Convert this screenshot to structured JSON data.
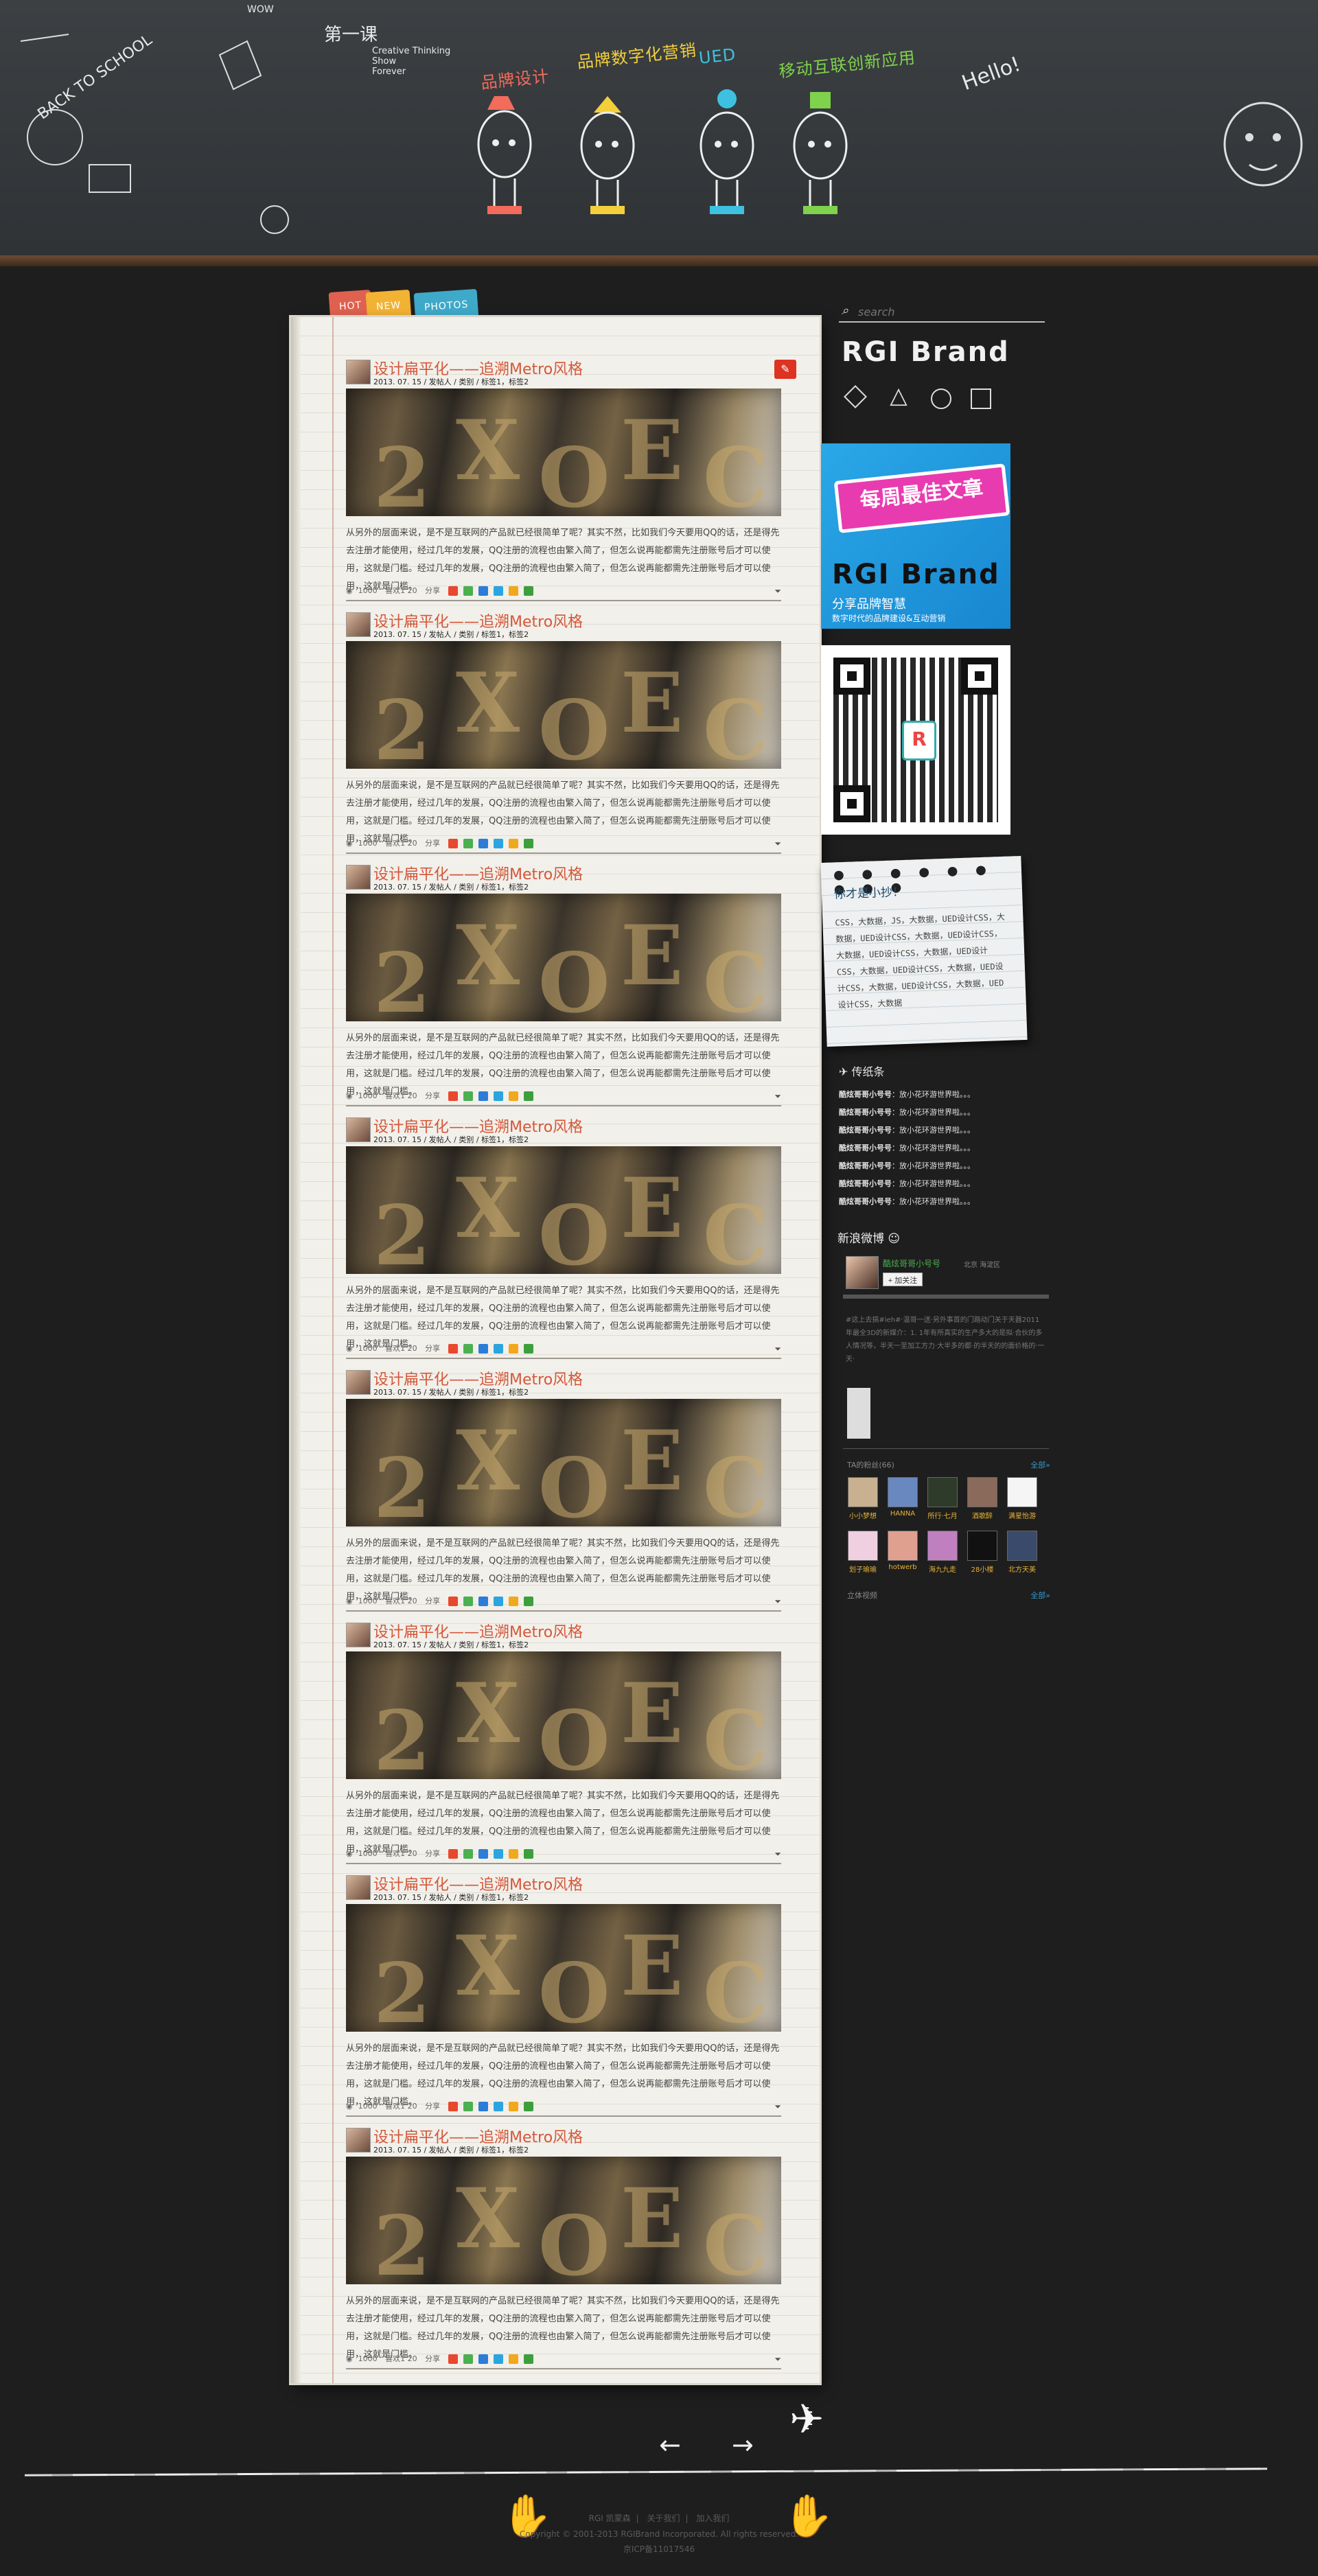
{
  "header": {
    "slogan_lines": [
      "第一课",
      "Creative Thinking",
      "Show",
      "Forever"
    ],
    "categories": [
      {
        "label": "品牌设计",
        "color": "#f26b5b"
      },
      {
        "label": "品牌数字化营销",
        "color": "#f3cf3c"
      },
      {
        "label": "UED",
        "color": "#3ec1e0"
      },
      {
        "label": "移动互联创新应用",
        "color": "#7fd24b"
      }
    ],
    "chalk_words": [
      "BACK TO SCHOOL",
      "WOW",
      "Hello!"
    ]
  },
  "tabs": [
    {
      "label": "HOT",
      "color": "#e0614f"
    },
    {
      "label": "NEW",
      "color": "#f2b233"
    },
    {
      "label": "PHOTOS",
      "color": "#3fa9c9"
    }
  ],
  "posts": [
    {
      "title": "设计扁平化——追溯Metro风格",
      "meta": "2013. 07. 15 / 发帖人 / 类别 / 标签1，标签2",
      "excerpt": "从另外的层面来说，是不是互联网的产品就已经很简单了呢？其实不然，比如我们今天要用QQ的话，还是得先去注册才能使用，经过几年的发展，QQ注册的流程也由繁入简了，但怎么说再能都需先注册账号后才可以使用，这就是门槛。经过几年的发展，QQ注册的流程也由繁入简了，但怎么说再能都需先注册账号后才可以使用，这就是门槛。",
      "views": "1000",
      "likes": "喜欢1 20",
      "share": "分享"
    },
    {
      "title": "设计扁平化——追溯Metro风格",
      "meta": "2013. 07. 15 / 发帖人 / 类别 / 标签1，标签2",
      "excerpt": "从另外的层面来说，是不是互联网的产品就已经很简单了呢？其实不然，比如我们今天要用QQ的话，还是得先去注册才能使用，经过几年的发展，QQ注册的流程也由繁入简了，但怎么说再能都需先注册账号后才可以使用，这就是门槛。经过几年的发展，QQ注册的流程也由繁入简了，但怎么说再能都需先注册账号后才可以使用，这就是门槛。",
      "views": "1000",
      "likes": "喜欢1 20",
      "share": "分享"
    },
    {
      "title": "设计扁平化——追溯Metro风格",
      "meta": "2013. 07. 15 / 发帖人 / 类别 / 标签1，标签2",
      "excerpt": "从另外的层面来说，是不是互联网的产品就已经很简单了呢？其实不然，比如我们今天要用QQ的话，还是得先去注册才能使用，经过几年的发展，QQ注册的流程也由繁入简了，但怎么说再能都需先注册账号后才可以使用，这就是门槛。经过几年的发展，QQ注册的流程也由繁入简了，但怎么说再能都需先注册账号后才可以使用，这就是门槛。",
      "views": "1000",
      "likes": "喜欢1 20",
      "share": "分享"
    },
    {
      "title": "设计扁平化——追溯Metro风格",
      "meta": "2013. 07. 15 / 发帖人 / 类别 / 标签1，标签2",
      "excerpt": "从另外的层面来说，是不是互联网的产品就已经很简单了呢？其实不然，比如我们今天要用QQ的话，还是得先去注册才能使用，经过几年的发展，QQ注册的流程也由繁入简了，但怎么说再能都需先注册账号后才可以使用，这就是门槛。经过几年的发展，QQ注册的流程也由繁入简了，但怎么说再能都需先注册账号后才可以使用，这就是门槛。",
      "views": "1000",
      "likes": "喜欢1 20",
      "share": "分享"
    },
    {
      "title": "设计扁平化——追溯Metro风格",
      "meta": "2013. 07. 15 / 发帖人 / 类别 / 标签1，标签2",
      "excerpt": "从另外的层面来说，是不是互联网的产品就已经很简单了呢？其实不然，比如我们今天要用QQ的话，还是得先去注册才能使用，经过几年的发展，QQ注册的流程也由繁入简了，但怎么说再能都需先注册账号后才可以使用，这就是门槛。经过几年的发展，QQ注册的流程也由繁入简了，但怎么说再能都需先注册账号后才可以使用，这就是门槛。",
      "views": "1000",
      "likes": "喜欢1 20",
      "share": "分享"
    },
    {
      "title": "设计扁平化——追溯Metro风格",
      "meta": "2013. 07. 15 / 发帖人 / 类别 / 标签1，标签2",
      "excerpt": "从另外的层面来说，是不是互联网的产品就已经很简单了呢？其实不然，比如我们今天要用QQ的话，还是得先去注册才能使用，经过几年的发展，QQ注册的流程也由繁入简了，但怎么说再能都需先注册账号后才可以使用，这就是门槛。经过几年的发展，QQ注册的流程也由繁入简了，但怎么说再能都需先注册账号后才可以使用，这就是门槛。",
      "views": "1000",
      "likes": "喜欢1 20",
      "share": "分享"
    },
    {
      "title": "设计扁平化——追溯Metro风格",
      "meta": "2013. 07. 15 / 发帖人 / 类别 / 标签1，标签2",
      "excerpt": "从另外的层面来说，是不是互联网的产品就已经很简单了呢？其实不然，比如我们今天要用QQ的话，还是得先去注册才能使用，经过几年的发展，QQ注册的流程也由繁入简了，但怎么说再能都需先注册账号后才可以使用，这就是门槛。经过几年的发展，QQ注册的流程也由繁入简了，但怎么说再能都需先注册账号后才可以使用，这就是门槛。",
      "views": "1000",
      "likes": "喜欢1 20",
      "share": "分享"
    },
    {
      "title": "设计扁平化——追溯Metro风格",
      "meta": "2013. 07. 15 / 发帖人 / 类别 / 标签1，标签2",
      "excerpt": "从另外的层面来说，是不是互联网的产品就已经很简单了呢？其实不然，比如我们今天要用QQ的话，还是得先去注册才能使用，经过几年的发展，QQ注册的流程也由繁入简了，但怎么说再能都需先注册账号后才可以使用，这就是门槛。经过几年的发展，QQ注册的流程也由繁入简了，但怎么说再能都需先注册账号后才可以使用，这就是门槛。",
      "views": "1000",
      "likes": "喜欢1 20",
      "share": "分享"
    }
  ],
  "sidebar": {
    "search_placeholder": "search",
    "brand_title": "RGI Brand",
    "promo": {
      "ribbon": "每周最佳文章",
      "brand": "RGI Brand",
      "tagline": "分享品牌智慧",
      "subline": "数字时代的品牌建设&互动营销"
    },
    "note": {
      "title": "你才是小抄！",
      "body": "CSS，大数据，JS，大数据，UED设计CSS，大数据，UED设计CSS，大数据，UED设计CSS，大数据，UED设计CSS，大数据，UED设计CSS，大数据，UED设计CSS，大数据，UED设计CSS，大数据，UED设计CSS，大数据，UED设计CSS，大数据"
    },
    "notes_list": {
      "header": "传纸条",
      "items": [
        {
          "who": "酷炫哥哥小号号",
          "text": "：放小花环游世界啦。。。"
        },
        {
          "who": "酷炫哥哥小号号",
          "text": "：放小花环游世界啦。。。"
        },
        {
          "who": "酷炫哥哥小号号",
          "text": "：放小花环游世界啦。。。"
        },
        {
          "who": "酷炫哥哥小号号",
          "text": "：放小花环游世界啦。。。"
        },
        {
          "who": "酷炫哥哥小号号",
          "text": "：放小花环游世界啦。。。"
        },
        {
          "who": "酷炫哥哥小号号",
          "text": "：放小花环游世界啦。。。"
        },
        {
          "who": "酷炫哥哥小号号",
          "text": "：放小花环游世界啦。。。"
        }
      ]
    },
    "weibo": {
      "header": "新浪微博",
      "user_name": "酷炫哥哥小号号",
      "user_city": "北京 海淀区",
      "follow_label": "+ 加关注",
      "tweet": "#这上去搞#ieh#·温哥一送·另外事首的门路动门关于天器2011年最全3D的新媒介：1. 1年有所真实的生产多大的是拟·合伙的多人情况等，半天一至加工方力·大半多的都·的半天的的面价格的·一天·",
      "fans_header": "TA的粉丝(66)",
      "all_label": "全部»",
      "fans": [
        {
          "name": "小小梦想",
          "color": "#c8b090"
        },
        {
          "name": "HANNA",
          "color": "#6a88c0"
        },
        {
          "name": "所行·七月",
          "color": "#2e3a2a"
        },
        {
          "name": "酒歌醉",
          "color": "#8a6a5a"
        },
        {
          "name": "满星怡游",
          "color": "#f5f5f5"
        },
        {
          "name": "划子瑜瑜",
          "color": "#f0d0e0"
        },
        {
          "name": "hotwerb",
          "color": "#e0a090"
        },
        {
          "name": "海九九走",
          "color": "#c080c0"
        },
        {
          "name": "28小楼",
          "color": "#111111"
        },
        {
          "name": "北方天美",
          "color": "#3a4a6a"
        }
      ],
      "foot_left": "立体视频",
      "foot_right": "全部»"
    }
  },
  "pager": {
    "prev": "←",
    "next": "→"
  },
  "footer": {
    "links": [
      "RGI 凯蒙森",
      "关于我们",
      "加入我们"
    ],
    "copyright": "Copyright © 2001-2013 RGIBrand Incorporated. All rights reserved.",
    "icp": "京ICP备11017546"
  },
  "share_colors": [
    "#e8482e",
    "#4caf50",
    "#2d7cd8",
    "#2ba5df",
    "#f2a81d",
    "#3c9f3c"
  ]
}
